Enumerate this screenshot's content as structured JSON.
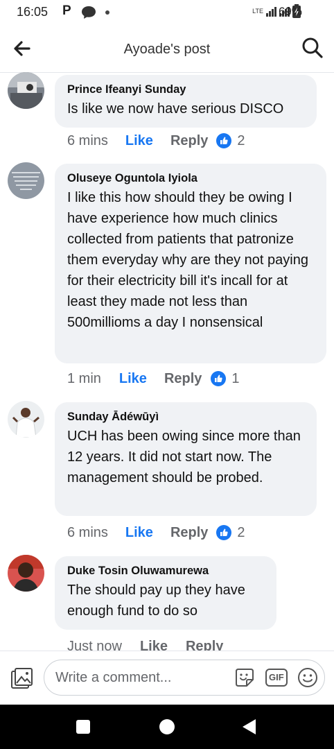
{
  "status_bar": {
    "time": "16:05",
    "p_icon": "P",
    "network": "LTE",
    "battery": "69%"
  },
  "header": {
    "title": "Ayoade's post"
  },
  "comments": [
    {
      "author": "Prince Ifeanyi Sunday",
      "text": "Is like we now have serious DISCO",
      "time": "6 mins",
      "like_label": "Like",
      "reply_label": "Reply",
      "reaction_count": "2",
      "reaction_icon": "thumbs-up-icon"
    },
    {
      "author": "Oluseye Oguntola Iyiola",
      "text": "I like this how should they be owing I have experience how much clinics collected from patients that patronize them everyday why are they not paying for their electricity bill it's incall for at least they made not less than  500millioms a day I nonsensical",
      "time": "1 min",
      "like_label": "Like",
      "reply_label": "Reply",
      "reaction_count": "1",
      "reaction_icon": "thumbs-up-icon"
    },
    {
      "author": "Sunday Ādéwūyì",
      "text": "UCH has been owing since more than 12 years. It did not start now. The management should be probed.",
      "time": "6 mins",
      "like_label": "Like",
      "reply_label": "Reply",
      "reaction_count": "2",
      "reaction_icon": "thumbs-up-icon"
    },
    {
      "author": "Duke Tosin Oluwamurewa",
      "text": "The should pay up they have enough  fund to do so",
      "time": "Just now",
      "like_label": "Like",
      "reply_label": "Reply"
    }
  ],
  "composer": {
    "placeholder": "Write a comment...",
    "gif_label": "GIF"
  },
  "colors": {
    "accent": "#1877f2",
    "bubble": "#f0f2f5",
    "muted": "#65676b"
  }
}
